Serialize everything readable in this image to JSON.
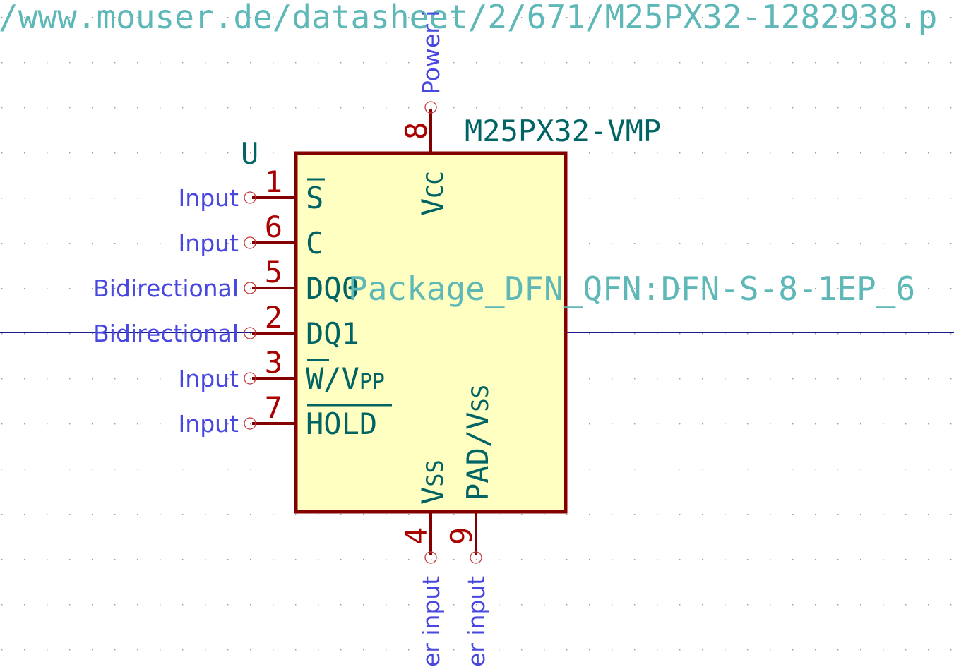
{
  "datasheet_url": "/www.mouser.de/datasheet/2/671/M25PX32-1282938.p",
  "footprint": "Package_DFN_QFN:DFN-S-8-1EP_6",
  "reference": "U",
  "value": "M25PX32-VMP",
  "colors": {
    "background": "#ffffff",
    "grid": "#9a9a9a",
    "body_fill": "#ffffc2",
    "body_stroke": "#840000",
    "pin_line": "#840000",
    "pin_number": "#a90000",
    "pin_name": "#006464",
    "pin_type": "#4848e0",
    "field_text": "#5fb8b8",
    "crosshair": "#1a1a8c"
  },
  "pins": {
    "p1": {
      "number": "1",
      "name": "S",
      "type": "Input",
      "name_overline": true
    },
    "p6": {
      "number": "6",
      "name": "C",
      "type": "Input"
    },
    "p5": {
      "number": "5",
      "name": "DQ0",
      "type": "Bidirectional"
    },
    "p2": {
      "number": "2",
      "name": "DQ1",
      "type": "Bidirectional"
    },
    "p3": {
      "number": "3",
      "name_main": "W",
      "name_rest": "/V",
      "name_sub": "PP",
      "type": "Input",
      "name_overline_part": "W"
    },
    "p7": {
      "number": "7",
      "name": "HOLD",
      "type": "Input",
      "name_overline": true
    },
    "p8": {
      "number": "8",
      "name_main": "V",
      "name_sub": "CC",
      "type": "Power input",
      "type_visible": "Power i"
    },
    "p4": {
      "number": "4",
      "name_main": "V",
      "name_sub": "SS",
      "type": "Power input",
      "type_visible": "er input"
    },
    "p9": {
      "number": "9",
      "name_main": "PAD/V",
      "name_sub": "SS",
      "type": "Power input",
      "type_visible": "er input"
    }
  }
}
